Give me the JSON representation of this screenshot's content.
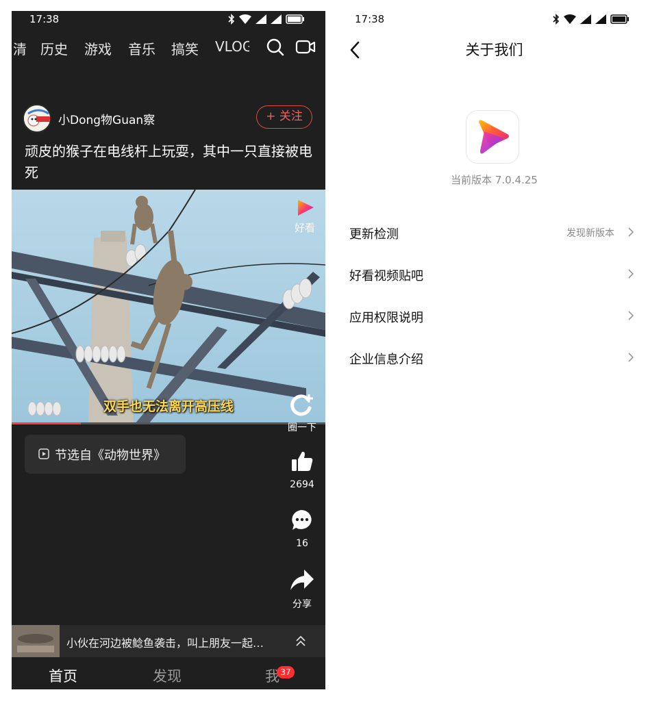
{
  "left": {
    "status": {
      "time": "17:38"
    },
    "channels": [
      {
        "label": "清"
      },
      {
        "label": "历史"
      },
      {
        "label": "游戏"
      },
      {
        "label": "音乐"
      },
      {
        "label": "搞笑"
      },
      {
        "label": "VLOG"
      }
    ],
    "author": {
      "name": "小Dong物Guan察",
      "follow_label": "+ 关注"
    },
    "video": {
      "title": "顽皮的猴子在电线杆上玩耍，其中一只直接被电死",
      "subtitle": "双手也无法离开高压线",
      "watermark": "好看",
      "progress": 0.22
    },
    "quan": {
      "label": "圈一下"
    },
    "source": {
      "label": "节选自《动物世界》"
    },
    "actions": {
      "likes": "2694",
      "comments": "16",
      "share_label": "分享"
    },
    "next_video": {
      "title": "小伙在河边被鲶鱼袭击，叫上朋友一起…"
    },
    "nav": {
      "home": "首页",
      "discover": "发现",
      "me": "我",
      "badge": "37"
    }
  },
  "right": {
    "status": {
      "time": "17:38"
    },
    "title": "关于我们",
    "version": "当前版本 7.0.4.25",
    "items": [
      {
        "label": "更新检测",
        "status": "发现新版本"
      },
      {
        "label": "好看视频贴吧",
        "status": ""
      },
      {
        "label": "应用权限说明",
        "status": ""
      },
      {
        "label": "企业信息介绍",
        "status": ""
      }
    ]
  },
  "colors": {
    "accent_red": "#ff3b3b",
    "subtitle_yellow": "#ffd84a",
    "dark_bg": "#1f1f1f"
  }
}
